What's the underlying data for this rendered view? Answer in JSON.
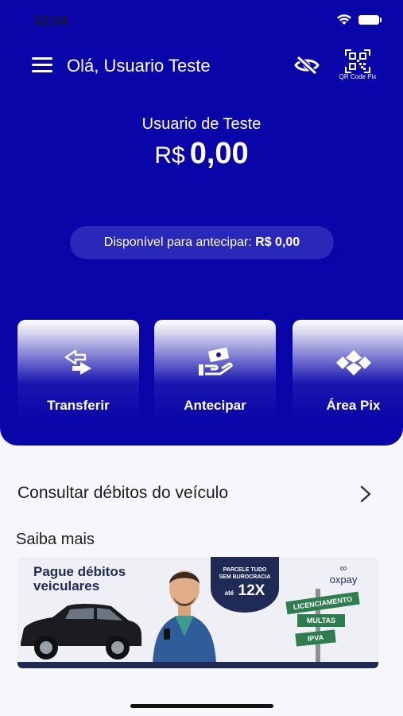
{
  "status_bar": {
    "time": "12:24"
  },
  "topbar": {
    "greeting": "Olá, Usuario Teste",
    "qr_label": "QR Code Pix"
  },
  "account": {
    "user_name": "Usuario de Teste",
    "currency": "R$",
    "amount": "0,00"
  },
  "antecipar_pill": {
    "label": "Disponível para antecipar:",
    "value": "R$ 0,00"
  },
  "actions": [
    {
      "label": "Transferir",
      "icon": "transfer-icon"
    },
    {
      "label": "Antecipar",
      "icon": "hand-money-icon"
    },
    {
      "label": "Área Pix",
      "icon": "pix-icon"
    }
  ],
  "consult": {
    "label": "Consultar débitos do veículo"
  },
  "saiba_mais": {
    "title": "Saiba mais"
  },
  "banner": {
    "headline_1": "Pague débitos",
    "headline_2": "veiculares",
    "ribbon_line_1": "PARCELE TUDO",
    "ribbon_line_2": "SEM BUROCRACIA",
    "ribbon_prefix": "até",
    "ribbon_value": "12X",
    "brand": "oxpay",
    "signs": [
      "LICENCIAMENTO",
      "MULTAS",
      "IPVA"
    ]
  },
  "colors": {
    "primary": "#0a05a8",
    "pill": "#2a28b8",
    "banner_navy": "#1f2a56",
    "sign_green": "#2e7d4f"
  }
}
